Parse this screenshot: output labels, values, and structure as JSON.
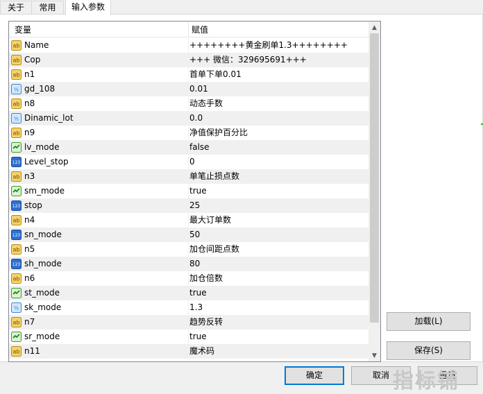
{
  "tabs": [
    {
      "label": "关于"
    },
    {
      "label": "常用"
    },
    {
      "label": "输入参数"
    }
  ],
  "table": {
    "col_variable": "变量",
    "col_value": "赋值",
    "rows": [
      {
        "icon": "ab",
        "name": "Name",
        "value": "++++++++黄金刷单1.3++++++++"
      },
      {
        "icon": "ab",
        "name": "Cop",
        "value": "+++ 微信：329695691+++"
      },
      {
        "icon": "ab",
        "name": "n1",
        "value": "首单下单0.01"
      },
      {
        "icon": "v2",
        "name": "gd_108",
        "value": "0.01"
      },
      {
        "icon": "ab",
        "name": "n8",
        "value": "动态手数"
      },
      {
        "icon": "v2",
        "name": "Dinamic_lot",
        "value": "0.0"
      },
      {
        "icon": "ab",
        "name": "n9",
        "value": "净值保护百分比"
      },
      {
        "icon": "bool",
        "name": "lv_mode",
        "value": "false"
      },
      {
        "icon": "123",
        "name": "Level_stop",
        "value": "0"
      },
      {
        "icon": "ab",
        "name": "n3",
        "value": "单笔止损点数"
      },
      {
        "icon": "bool",
        "name": "sm_mode",
        "value": "true"
      },
      {
        "icon": "123",
        "name": "stop",
        "value": "25"
      },
      {
        "icon": "ab",
        "name": "n4",
        "value": "最大订单数"
      },
      {
        "icon": "123",
        "name": "sn_mode",
        "value": "50"
      },
      {
        "icon": "ab",
        "name": "n5",
        "value": "加仓间距点数"
      },
      {
        "icon": "123",
        "name": "sh_mode",
        "value": "80"
      },
      {
        "icon": "ab",
        "name": "n6",
        "value": "加仓倍数"
      },
      {
        "icon": "bool",
        "name": "st_mode",
        "value": "true"
      },
      {
        "icon": "v2",
        "name": "sk_mode",
        "value": "1.3"
      },
      {
        "icon": "ab",
        "name": "n7",
        "value": "趋势反转"
      },
      {
        "icon": "bool",
        "name": "sr_mode",
        "value": "true"
      },
      {
        "icon": "ab",
        "name": "n11",
        "value": "魔术码"
      }
    ]
  },
  "buttons": {
    "load": "加载(L)",
    "save": "保存(S)",
    "ok": "确定",
    "cancel": "取消",
    "reset": "重设"
  },
  "watermark": "指标铺",
  "colors": {
    "default_button_border": "#0078d7",
    "list_border": "#828790",
    "alt_row": "#f0f0f0"
  }
}
